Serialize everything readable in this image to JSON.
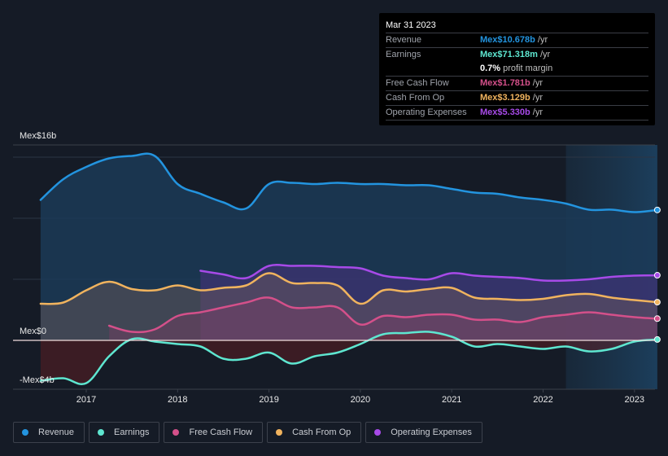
{
  "tooltip": {
    "date": "Mar 31 2023",
    "rows": [
      {
        "label": "Revenue",
        "value": "Mex$10.678b",
        "unit": "/yr",
        "color": "#2394df"
      },
      {
        "label": "Earnings",
        "value": "Mex$71.318m",
        "unit": "/yr",
        "color": "#5ee6d0"
      },
      {
        "label": "",
        "value": "0.7%",
        "unit": "profit margin",
        "color": "#ffffff"
      },
      {
        "label": "Free Cash Flow",
        "value": "Mex$1.781b",
        "unit": "/yr",
        "color": "#d4508a"
      },
      {
        "label": "Cash From Op",
        "value": "Mex$3.129b",
        "unit": "/yr",
        "color": "#f0b35e"
      },
      {
        "label": "Operating Expenses",
        "value": "Mex$5.330b",
        "unit": "/yr",
        "color": "#a74ae8"
      }
    ]
  },
  "legend": [
    {
      "label": "Revenue",
      "color": "#2394df"
    },
    {
      "label": "Earnings",
      "color": "#5ee6d0"
    },
    {
      "label": "Free Cash Flow",
      "color": "#d4508a"
    },
    {
      "label": "Cash From Op",
      "color": "#f0b35e"
    },
    {
      "label": "Operating Expenses",
      "color": "#a74ae8"
    }
  ],
  "chart_data": {
    "type": "area",
    "title": "",
    "xlabel": "",
    "ylabel": "",
    "y_unit": "Mex$ billions",
    "ylim": [
      -4,
      16
    ],
    "xlim": [
      2016.48,
      2023.25
    ],
    "y_tick_labels": [
      {
        "value": 16,
        "label": "Mex$16b"
      },
      {
        "value": 0,
        "label": "Mex$0"
      },
      {
        "value": -4,
        "label": "-Mex$4b"
      }
    ],
    "gridlines": [
      15,
      10,
      5
    ],
    "x_ticks": [
      2017,
      2018,
      2019,
      2020,
      2021,
      2022,
      2023
    ],
    "highlight_range": [
      2022.25,
      2023.25
    ],
    "x": [
      2016.5,
      2016.75,
      2017.0,
      2017.25,
      2017.5,
      2017.75,
      2018.0,
      2018.25,
      2018.5,
      2018.75,
      2019.0,
      2019.25,
      2019.5,
      2019.75,
      2020.0,
      2020.25,
      2020.5,
      2020.75,
      2021.0,
      2021.25,
      2021.5,
      2021.75,
      2022.0,
      2022.25,
      2022.5,
      2022.75,
      2023.0,
      2023.25
    ],
    "series": [
      {
        "name": "Revenue",
        "color": "#2394df",
        "values": [
          11.5,
          13.2,
          14.2,
          14.9,
          15.1,
          15.1,
          12.8,
          12.0,
          11.3,
          10.8,
          12.8,
          12.9,
          12.8,
          12.9,
          12.8,
          12.8,
          12.7,
          12.7,
          12.4,
          12.1,
          12.0,
          11.7,
          11.5,
          11.2,
          10.7,
          10.7,
          10.5,
          10.678
        ]
      },
      {
        "name": "Operating Expenses",
        "color": "#a74ae8",
        "values": [
          null,
          null,
          null,
          null,
          null,
          null,
          null,
          5.7,
          5.4,
          5.1,
          6.1,
          6.1,
          6.1,
          6.0,
          5.9,
          5.3,
          5.1,
          5.0,
          5.5,
          5.3,
          5.2,
          5.1,
          4.9,
          4.9,
          5.0,
          5.2,
          5.3,
          5.33
        ]
      },
      {
        "name": "Cash From Op",
        "color": "#f0b35e",
        "values": [
          3.0,
          3.1,
          4.1,
          4.8,
          4.2,
          4.1,
          4.5,
          4.1,
          4.3,
          4.5,
          5.5,
          4.7,
          4.7,
          4.5,
          3.0,
          4.1,
          4.0,
          4.2,
          4.3,
          3.5,
          3.4,
          3.3,
          3.4,
          3.7,
          3.8,
          3.5,
          3.3,
          3.129
        ]
      },
      {
        "name": "Free Cash Flow",
        "color": "#d4508a",
        "values": [
          null,
          null,
          null,
          1.2,
          0.7,
          0.9,
          2.0,
          2.3,
          2.7,
          3.1,
          3.5,
          2.7,
          2.7,
          2.7,
          1.3,
          2.0,
          1.9,
          2.1,
          2.1,
          1.7,
          1.7,
          1.5,
          1.9,
          2.1,
          2.3,
          2.1,
          1.9,
          1.781
        ]
      },
      {
        "name": "Earnings",
        "color": "#5ee6d0",
        "values": [
          -3.3,
          -3.1,
          -3.5,
          -1.3,
          0.1,
          -0.1,
          -0.3,
          -0.5,
          -1.5,
          -1.5,
          -1.0,
          -1.9,
          -1.3,
          -1.0,
          -0.3,
          0.5,
          0.6,
          0.7,
          0.3,
          -0.5,
          -0.3,
          -0.5,
          -0.7,
          -0.5,
          -0.9,
          -0.7,
          -0.1,
          0.071
        ]
      }
    ]
  }
}
